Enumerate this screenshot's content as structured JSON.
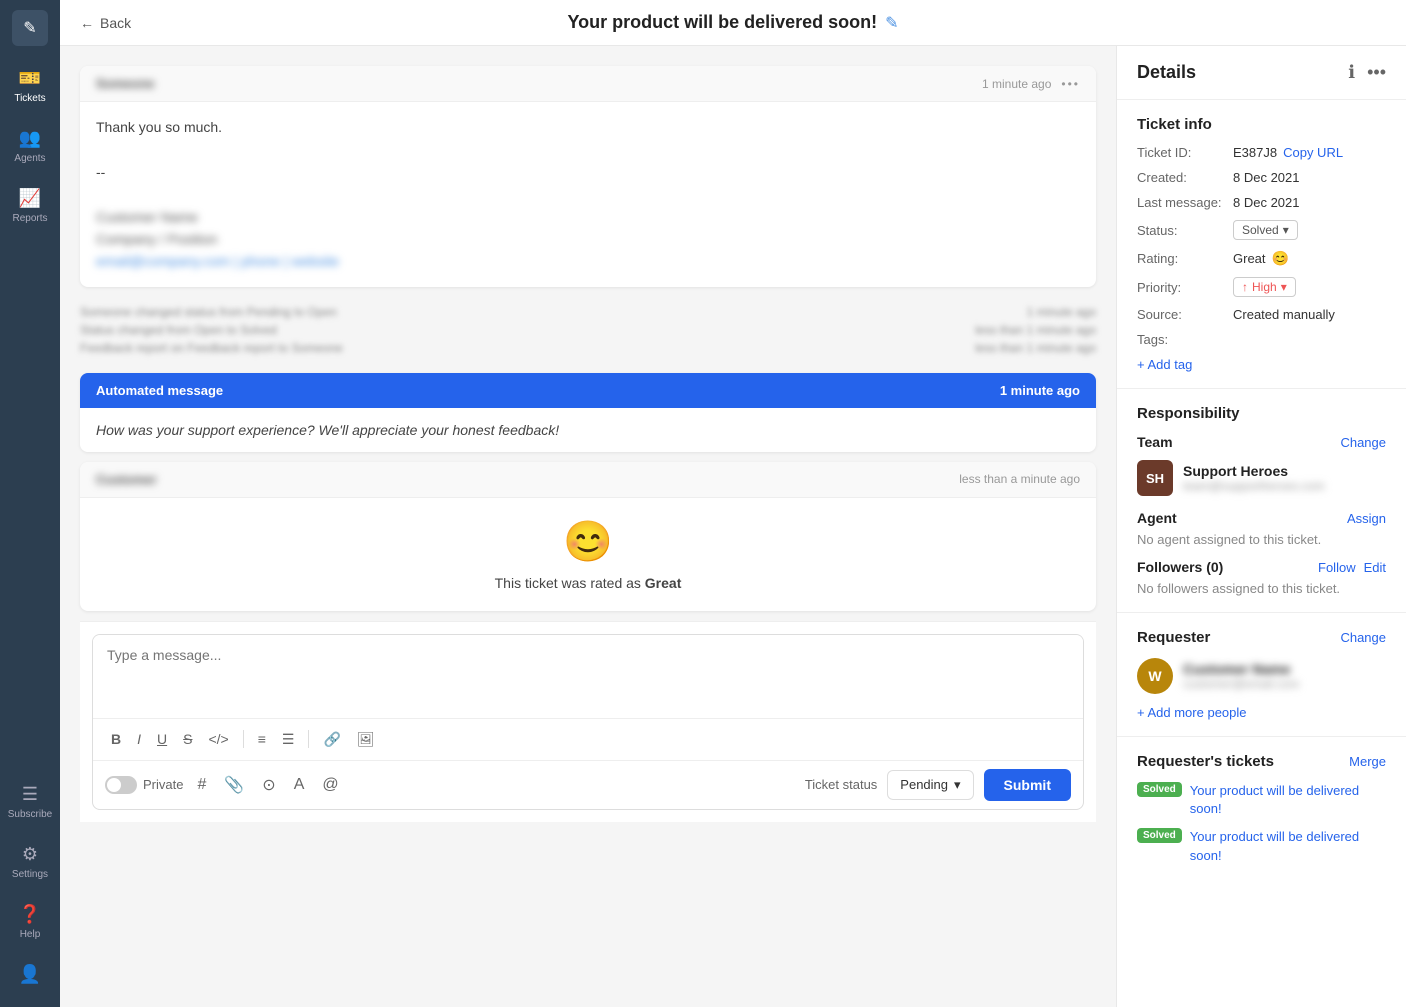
{
  "sidebar": {
    "logo_icon": "✎",
    "items": [
      {
        "id": "tickets",
        "label": "Tickets",
        "icon": "🎫",
        "active": true
      },
      {
        "id": "agents",
        "label": "Agents",
        "icon": "👥",
        "active": false
      },
      {
        "id": "reports",
        "label": "Reports",
        "icon": "📈",
        "active": false
      }
    ],
    "bottom_items": [
      {
        "id": "subscribe",
        "label": "Subscribe",
        "icon": "☰"
      },
      {
        "id": "settings",
        "label": "Settings",
        "icon": "⚙"
      },
      {
        "id": "help",
        "label": "Help",
        "icon": "?"
      },
      {
        "id": "profile",
        "label": "Profile",
        "icon": "👤"
      }
    ]
  },
  "header": {
    "back_label": "Back",
    "title": "Your product will be delivered soon!",
    "edit_icon": "✎"
  },
  "messages": [
    {
      "id": "msg1",
      "sender": "Customer",
      "time": "1 minute ago",
      "body_line1": "Thank you so much.",
      "body_line2": "--",
      "body_blurred1": "Customer name",
      "body_blurred2": "Company name",
      "body_blurred3": "Contact info"
    }
  ],
  "activity": [
    {
      "text": "Someone changed status from Pending to Open",
      "time": "1 minute ago"
    },
    {
      "text": "Status changed from Open to Solved",
      "time": "less than 1 minute ago"
    },
    {
      "text": "Feedback report on Feedback report to Someone",
      "time": "less than 1 minute ago"
    }
  ],
  "automated": {
    "label": "Automated message",
    "time": "1 minute ago",
    "body": "How was your support experience? We'll appreciate your honest feedback!"
  },
  "rating_message": {
    "sender": "Customer",
    "time": "less than a minute ago",
    "smiley": "😊",
    "text_prefix": "This ticket was rated as ",
    "rating": "Great"
  },
  "compose": {
    "placeholder": "Type a message...",
    "private_label": "Private",
    "ticket_status_label": "Ticket status",
    "status_value": "Pending",
    "submit_label": "Submit"
  },
  "details": {
    "title": "Details",
    "ticket_info": {
      "section_title": "Ticket info",
      "ticket_id_label": "Ticket ID:",
      "ticket_id": "E387J8",
      "copy_url_label": "Copy URL",
      "created_label": "Created:",
      "created_value": "8 Dec 2021",
      "last_message_label": "Last message:",
      "last_message_value": "8 Dec 2021",
      "status_label": "Status:",
      "status_value": "Solved",
      "rating_label": "Rating:",
      "rating_value": "Great",
      "rating_emoji": "😊",
      "priority_label": "Priority:",
      "priority_value": "High",
      "source_label": "Source:",
      "source_value": "Created manually",
      "tags_label": "Tags:",
      "add_tag_label": "+ Add tag"
    },
    "responsibility": {
      "section_title": "Responsibility",
      "team_label": "Team",
      "team_change": "Change",
      "team_initials": "SH",
      "team_name": "Support Heroes",
      "team_sub": "team@supportheroes.com",
      "agent_label": "Agent",
      "agent_assign": "Assign",
      "no_agent": "No agent assigned to this ticket.",
      "followers_label": "Followers (0)",
      "followers_follow": "Follow",
      "followers_edit": "Edit",
      "no_followers": "No followers assigned to this ticket."
    },
    "requester": {
      "section_title": "Requester",
      "change_label": "Change",
      "avatar_letter": "W",
      "name": "Customer Name",
      "email": "customer@email.com",
      "add_people": "+ Add more people"
    },
    "requester_tickets": {
      "section_title": "Requester's tickets",
      "merge_label": "Merge",
      "tickets": [
        {
          "status": "Solved",
          "text": "Your product will be delivered soon!"
        },
        {
          "status": "Solved",
          "text": "Your product will be delivered soon!"
        }
      ]
    }
  }
}
